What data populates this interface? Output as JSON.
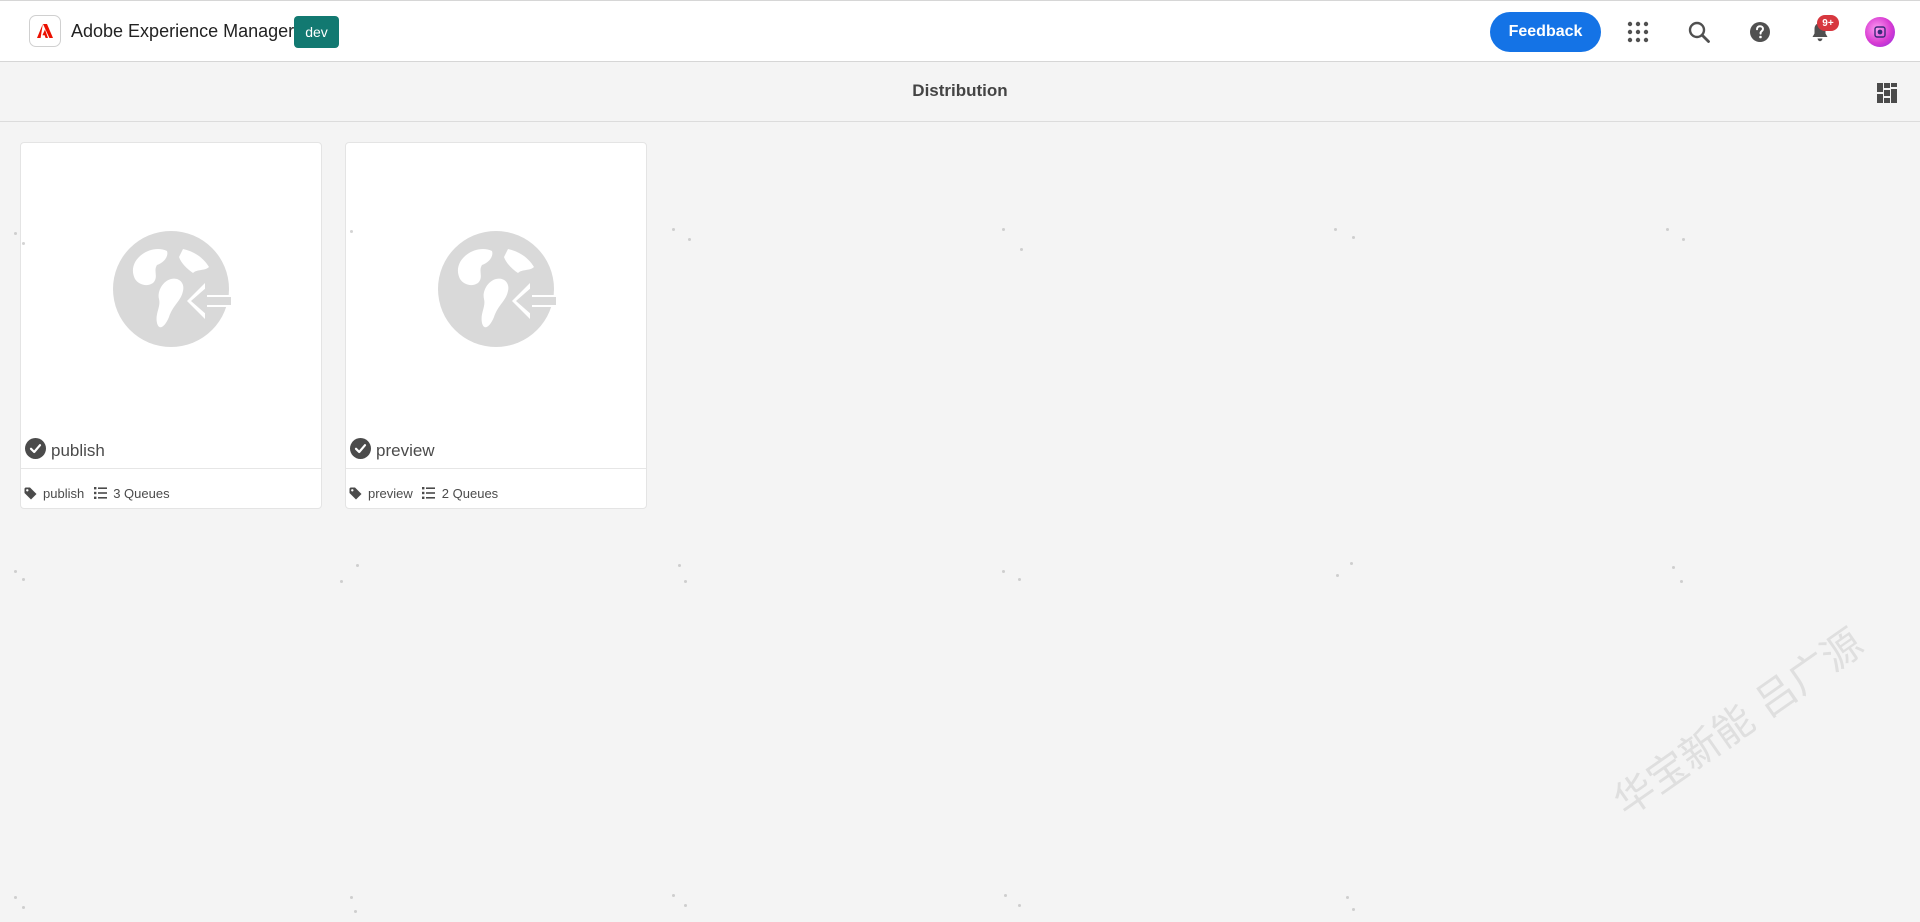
{
  "header": {
    "app_name": "Adobe Experience Manager",
    "env_badge": "dev",
    "feedback_label": "Feedback",
    "notification_badge": "9+",
    "icons": [
      "adobe-logo-icon",
      "app-grid-icon",
      "search-icon",
      "help-icon",
      "bell-icon",
      "avatar"
    ]
  },
  "titlebar": {
    "title": "Distribution",
    "view_switcher_icon": "card-view-icon"
  },
  "agents": [
    {
      "title": "publish",
      "status_icon": "check-circle-icon",
      "thumbnail_icon": "globe-arrow-icon",
      "tag": "publish",
      "queues": "3 Queues"
    },
    {
      "title": "preview",
      "status_icon": "check-circle-icon",
      "thumbnail_icon": "globe-arrow-icon",
      "tag": "preview",
      "queues": "2 Queues"
    }
  ],
  "watermark": "华宝新能 吕广源",
  "colors": {
    "accent": "#1473e6",
    "env_badge": "#127971",
    "notification": "#d7373f",
    "background": "#f4f4f4"
  }
}
